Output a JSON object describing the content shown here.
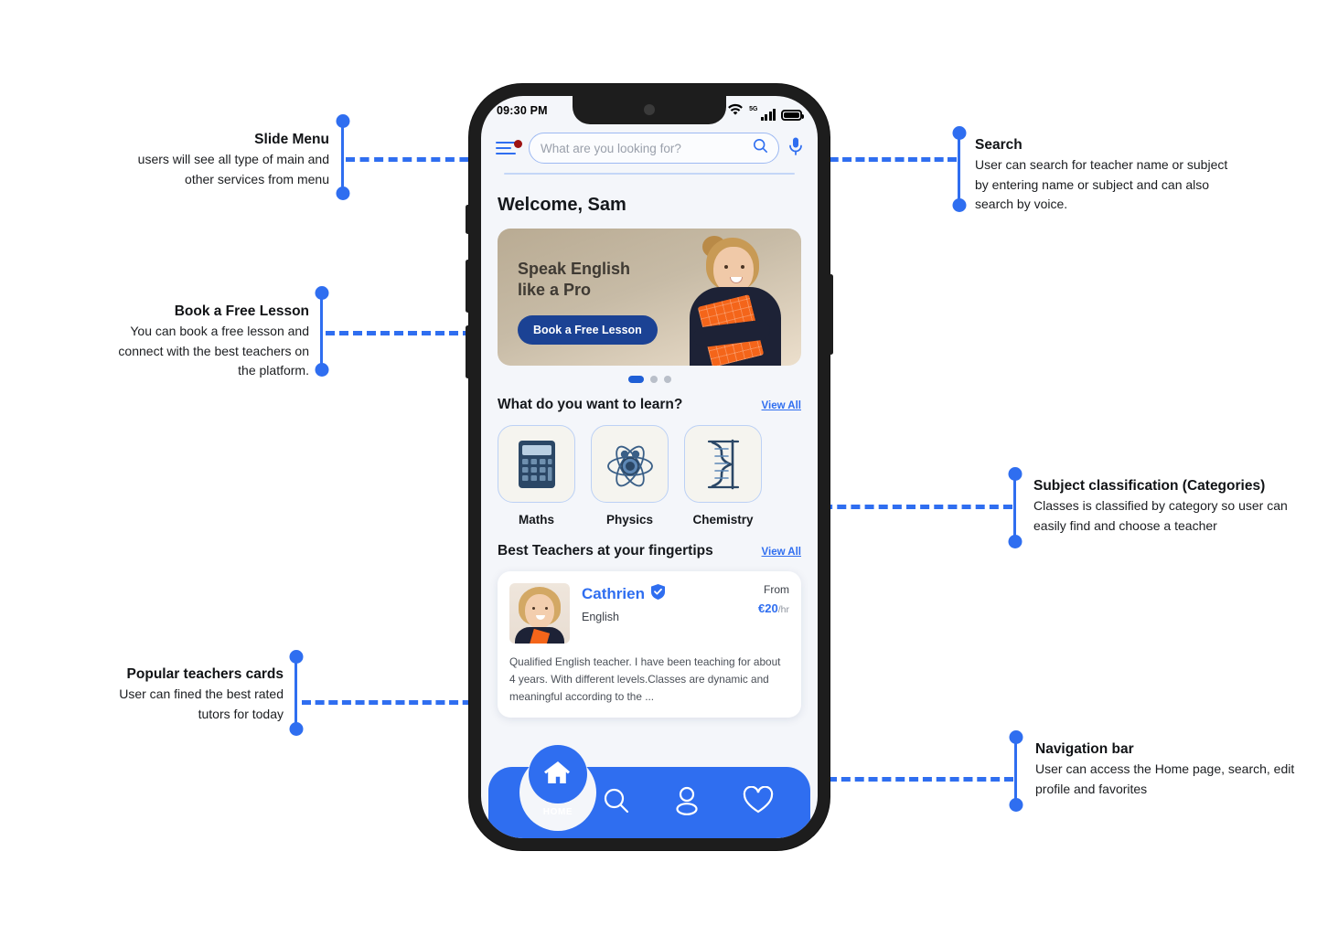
{
  "annotations": [
    {
      "id": "slide-menu",
      "title": "Slide Menu",
      "desc": "users will see all type of main and other services from menu"
    },
    {
      "id": "book-free-lesson",
      "title": "Book a Free Lesson",
      "desc": "You can book a free lesson and connect with the best teachers on the platform."
    },
    {
      "id": "popular-teachers-cards",
      "title": "Popular teachers cards",
      "desc": "User can fined the best rated tutors for today"
    },
    {
      "id": "search",
      "title": "Search",
      "desc": "User can search for teacher name or subject by entering name or subject and can also search by voice."
    },
    {
      "id": "subject-classification",
      "title": "Subject classification (Categories)",
      "desc": "Classes is classified by category so user can easily find and choose a teacher"
    },
    {
      "id": "navigation-bar",
      "title": "Navigation bar",
      "desc": "User can access the Home page, search, edit profile and favorites"
    }
  ],
  "phone": {
    "status_bar": {
      "time": "09:30 PM",
      "network_label": "5G",
      "icons": [
        "bluetooth-icon",
        "wifi-icon",
        "signal-icon",
        "battery-icon"
      ]
    },
    "top_bar": {
      "menu_icon": "hamburger-menu-icon",
      "has_notification_badge": true,
      "search_placeholder": "What are you looking for?",
      "search_value": "",
      "search_icon": "magnifier-icon",
      "voice_icon": "microphone-icon"
    },
    "welcome": "Welcome, Sam",
    "banner": {
      "title_line1": "Speak English",
      "title_line2": "like a Pro",
      "cta": "Book a Free Lesson",
      "slide_count": 3,
      "active_slide": 1
    },
    "categories_section": {
      "heading": "What do you want to learn?",
      "view_all": "View All",
      "items": [
        {
          "label": "Maths",
          "icon": "calculator-icon"
        },
        {
          "label": "Physics",
          "icon": "atom-icon"
        },
        {
          "label": "Chemistry",
          "icon": "dna-icon"
        }
      ]
    },
    "teachers_section": {
      "heading": "Best Teachers at your fingertips",
      "view_all": "View All",
      "card": {
        "name": "Cathrien",
        "verified": true,
        "subject": "English",
        "price_label": "From",
        "price": "€20",
        "price_unit": "/hr",
        "description": "Qualified English teacher. I have been teaching for about 4 years. With different levels.Classes are dynamic and meaningful according to the ..."
      }
    },
    "nav_bar": {
      "home_label": "HOME",
      "items": [
        {
          "name": "home",
          "icon": "home-icon",
          "active": true
        },
        {
          "name": "search",
          "icon": "search-icon",
          "active": false
        },
        {
          "name": "profile",
          "icon": "user-icon",
          "active": false
        },
        {
          "name": "favorites",
          "icon": "heart-icon",
          "active": false
        }
      ]
    }
  },
  "colors": {
    "accent_blue": "#2f6ef0",
    "deep_blue": "#1b4294",
    "badge_red": "#9e1313",
    "screen_bg": "#f4f6fa",
    "frame": "#1d1d1d"
  }
}
